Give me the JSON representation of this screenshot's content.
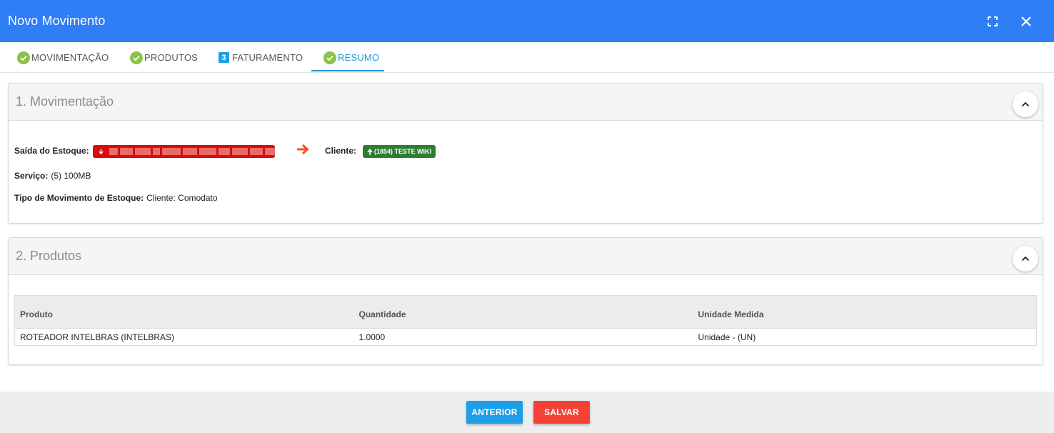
{
  "window": {
    "title": "Novo Movimento"
  },
  "tabs": [
    {
      "label": "MOVIMENTAÇÃO",
      "state": "done"
    },
    {
      "label": "PRODUTOS",
      "state": "done"
    },
    {
      "label": "FATURAMENTO",
      "state": "step",
      "step_number": "3"
    },
    {
      "label": "RESUMO",
      "state": "active"
    }
  ],
  "movimentacao": {
    "title": "1. Movimentação",
    "saida_label": "Saída do Estoque:",
    "cliente_label": "Cliente:",
    "cliente_badge": "(1854) TESTE WIKI",
    "servico_label": "Serviço:",
    "servico_value": "(5) 100MB",
    "tipo_label": "Tipo de Movimento de Estoque:",
    "tipo_value": "Cliente: Comodato"
  },
  "produtos": {
    "title": "2. Produtos",
    "columns": [
      "Produto",
      "Quantidade",
      "Unidade Medida"
    ],
    "rows": [
      [
        "ROTEADOR INTELBRAS (INTELBRAS)",
        "1.0000",
        "Unidade - (UN)"
      ]
    ]
  },
  "footer": {
    "prev_label": "ANTERIOR",
    "save_label": "SALVAR"
  },
  "colors": {
    "header": "#2f7ef5",
    "tab_active": "#2296d9",
    "check": "#8bc34a",
    "red_badge": "#d80d0d",
    "green_badge": "#2e7d32",
    "arrow": "#f4511e",
    "prev_button": "#1e9ee8",
    "save_button": "#f44336"
  },
  "icons": {
    "maximize": "maximize-icon",
    "close": "close-icon",
    "check": "check-circle-icon",
    "collapse": "chevron-up-icon",
    "arrow": "arrow-right-icon",
    "saida": "arrow-down-icon",
    "cliente": "arrow-up-icon"
  }
}
